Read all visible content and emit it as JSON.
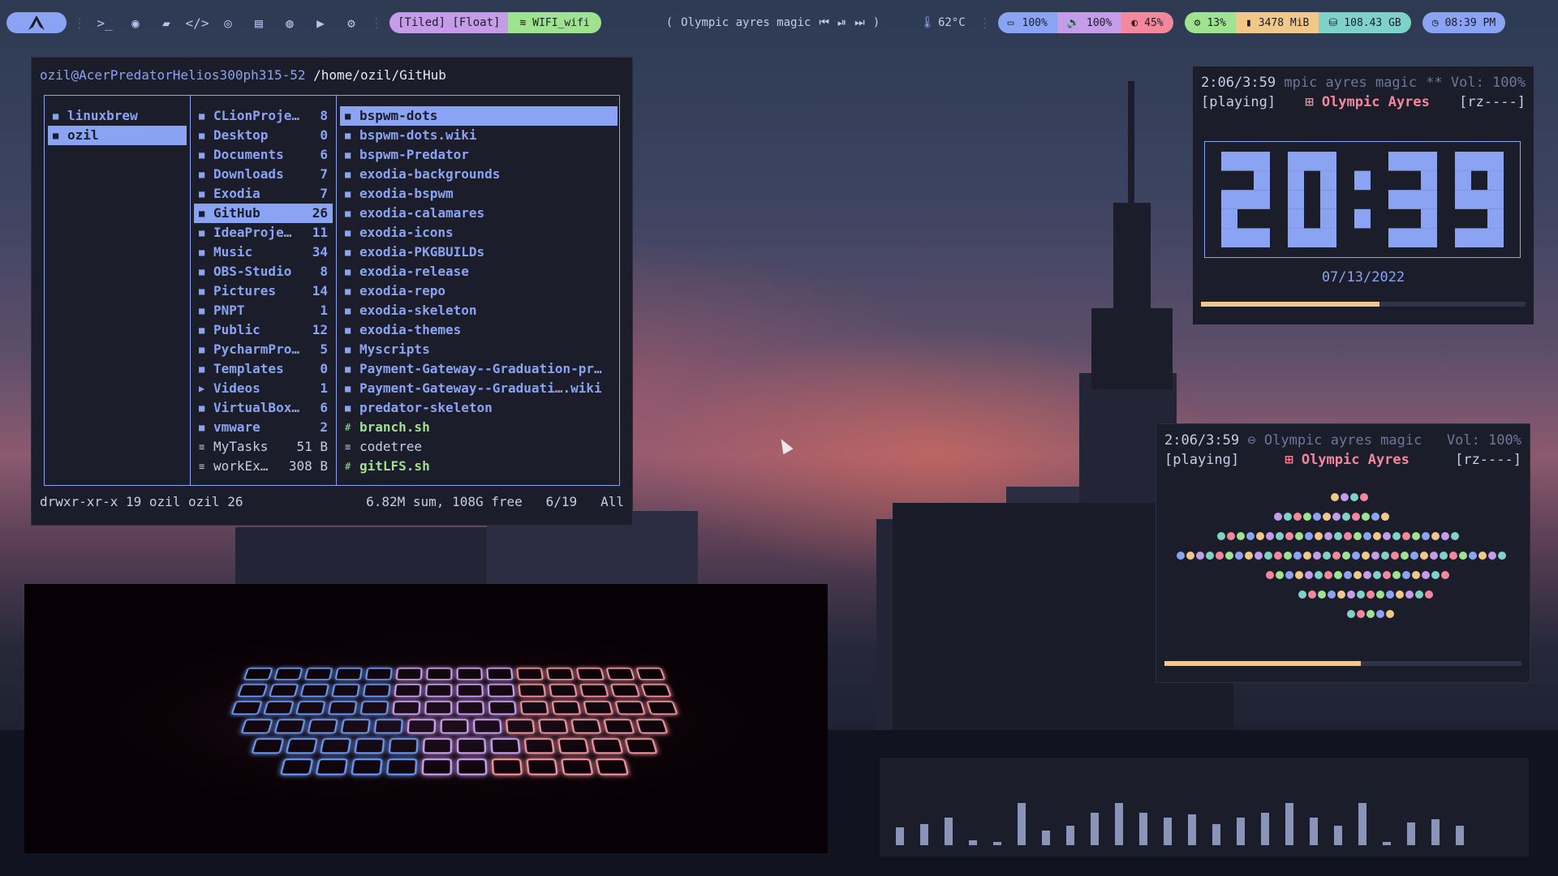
{
  "topbar": {
    "logo_icon": "arch-logo-icon",
    "launchers": [
      "terminal-icon",
      "firefox-icon",
      "folder-icon",
      "code-icon",
      "github-icon",
      "notes-icon",
      "chat-icon",
      "youtube-icon",
      "gear-icon"
    ],
    "layout_label": "[Tiled] [Float]",
    "wifi_label": "WIFI_wifi",
    "music_title": "Olympic ayres magic",
    "temperature": "62°C",
    "battery": "100%",
    "volume": "100%",
    "brightness": "45%",
    "cpu": "13%",
    "memory": "3478 MiB",
    "disk": "108.43 GB",
    "clock": "08:39 PM"
  },
  "file_manager": {
    "user_host": "ozil@AcerPredatorHelios300ph315-52",
    "path": "/home/ozil/GitHub",
    "col1": [
      {
        "name": "linuxbrew",
        "type": "dir",
        "selected": false
      },
      {
        "name": "ozil",
        "type": "dir",
        "selected": true
      }
    ],
    "col2": [
      {
        "name": "CLionProje…",
        "count": "8",
        "type": "dir"
      },
      {
        "name": "Desktop",
        "count": "0",
        "type": "dir"
      },
      {
        "name": "Documents",
        "count": "6",
        "type": "dir"
      },
      {
        "name": "Downloads",
        "count": "7",
        "type": "dir"
      },
      {
        "name": "Exodia",
        "count": "7",
        "type": "dir"
      },
      {
        "name": "GitHub",
        "count": "26",
        "type": "dir",
        "selected": true
      },
      {
        "name": "IdeaProje…",
        "count": "11",
        "type": "dir"
      },
      {
        "name": "Music",
        "count": "34",
        "type": "dir"
      },
      {
        "name": "OBS-Studio",
        "count": "8",
        "type": "dir"
      },
      {
        "name": "Pictures",
        "count": "14",
        "type": "dir"
      },
      {
        "name": "PNPT",
        "count": "1",
        "type": "dir"
      },
      {
        "name": "Public",
        "count": "12",
        "type": "dir"
      },
      {
        "name": "PycharmPro…",
        "count": "5",
        "type": "dir"
      },
      {
        "name": "Templates",
        "count": "0",
        "type": "dir"
      },
      {
        "name": "Videos",
        "count": "1",
        "type": "video"
      },
      {
        "name": "VirtualBox…",
        "count": "6",
        "type": "dir"
      },
      {
        "name": "vmware",
        "count": "2",
        "type": "dir"
      },
      {
        "name": "MyTasks",
        "count": "51 B",
        "type": "file"
      },
      {
        "name": "workEx…",
        "count": "308 B",
        "type": "file"
      }
    ],
    "col3": [
      {
        "name": "bspwm-dots",
        "type": "dir",
        "selected": true
      },
      {
        "name": "bspwm-dots.wiki",
        "type": "dir"
      },
      {
        "name": "bspwm-Predator",
        "type": "dir"
      },
      {
        "name": "exodia-backgrounds",
        "type": "dir"
      },
      {
        "name": "exodia-bspwm",
        "type": "dir"
      },
      {
        "name": "exodia-calamares",
        "type": "dir"
      },
      {
        "name": "exodia-icons",
        "type": "dir"
      },
      {
        "name": "exodia-PKGBUILDs",
        "type": "dir"
      },
      {
        "name": "exodia-release",
        "type": "dir"
      },
      {
        "name": "exodia-repo",
        "type": "dir"
      },
      {
        "name": "exodia-skeleton",
        "type": "dir"
      },
      {
        "name": "exodia-themes",
        "type": "dir"
      },
      {
        "name": "Myscripts",
        "type": "dir"
      },
      {
        "name": "Payment-Gateway--Graduation-pr…",
        "type": "dir"
      },
      {
        "name": "Payment-Gateway--Graduati….wiki",
        "type": "dir"
      },
      {
        "name": "predator-skeleton",
        "type": "dir"
      },
      {
        "name": "branch.sh",
        "type": "exe"
      },
      {
        "name": "codetree",
        "type": "file"
      },
      {
        "name": "gitLFS.sh",
        "type": "exe"
      }
    ],
    "status_perms": "drwxr-xr-x 19 ozil ozil 26",
    "status_summary": "6.82M sum, 108G free",
    "status_pos": "6/19",
    "status_scroll": "All"
  },
  "clock_widget": {
    "elapsed": "2:06/3:59",
    "title_scroll": "mpic ayres magic",
    "volume": "** Vol: 100%",
    "state": "[playing]",
    "artist": "Olympic Ayres",
    "flags": "[rz----]",
    "time": "20:39",
    "date": "07/13/2022",
    "progress": 0.55
  },
  "visualizer_widget": {
    "elapsed": "2:06/3:59",
    "title": "Olympic ayres magic",
    "volume": "Vol: 100%",
    "state": "[playing]",
    "artist": "Olympic Ayres",
    "flags": "[rz----]",
    "progress": 0.55
  },
  "colors": {
    "accent": "#8aa3f2",
    "purple": "#c59ce8",
    "green": "#9fe28f",
    "pink": "#f3879b",
    "yellow": "#f2c88a",
    "teal": "#7fd2c8",
    "panel": "#1b1d2b"
  }
}
